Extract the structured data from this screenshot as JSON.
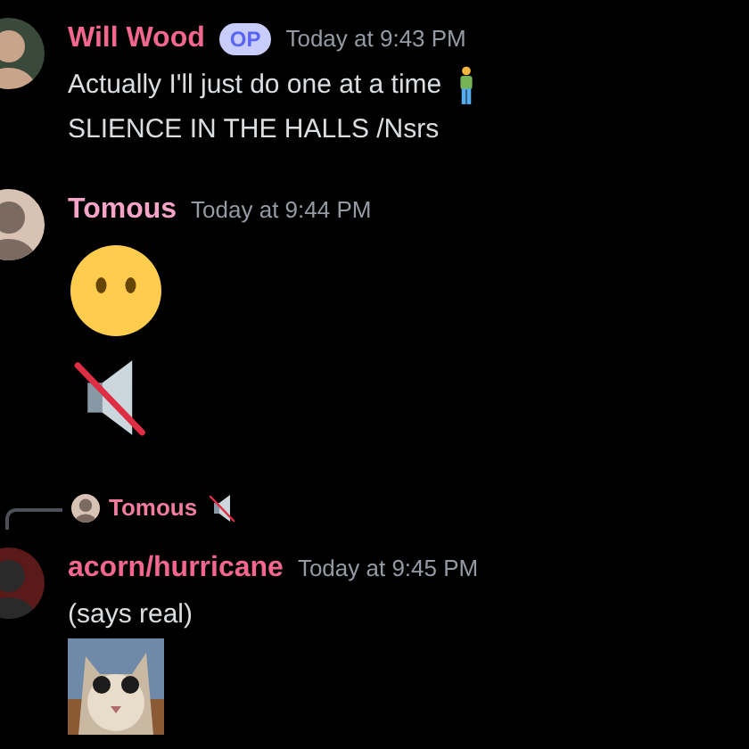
{
  "messages": [
    {
      "author": "Will Wood",
      "color": "#f2668f",
      "badge": "OP",
      "timestamp": "Today at 9:43 PM",
      "lines": [
        {
          "kind": "line",
          "parts": [
            {
              "kind": "text",
              "text": "Actually I'll just do one at a time"
            },
            {
              "kind": "person"
            }
          ]
        },
        {
          "kind": "line",
          "parts": [
            {
              "kind": "text",
              "text": "SLIENCE IN THE HALLS /Nsrs"
            }
          ]
        }
      ]
    },
    {
      "author": "Tomous",
      "color": "#f5a3c7",
      "timestamp": "Today at 9:44 PM",
      "lines": [
        {
          "kind": "big",
          "parts": [
            {
              "kind": "face"
            }
          ]
        },
        {
          "kind": "big",
          "parts": [
            {
              "kind": "muted"
            }
          ]
        }
      ]
    },
    {
      "author": "acorn/hurricane",
      "color": "#f2668f",
      "timestamp": "Today at 9:45 PM",
      "reply": {
        "author": "Tomous",
        "color": "#f07ca0",
        "parts": [
          {
            "kind": "muted"
          }
        ]
      },
      "lines": [
        {
          "kind": "line",
          "parts": [
            {
              "kind": "text",
              "text": "(says real)"
            }
          ]
        },
        {
          "parts": [
            {
              "kind": "picture"
            }
          ]
        }
      ]
    }
  ]
}
